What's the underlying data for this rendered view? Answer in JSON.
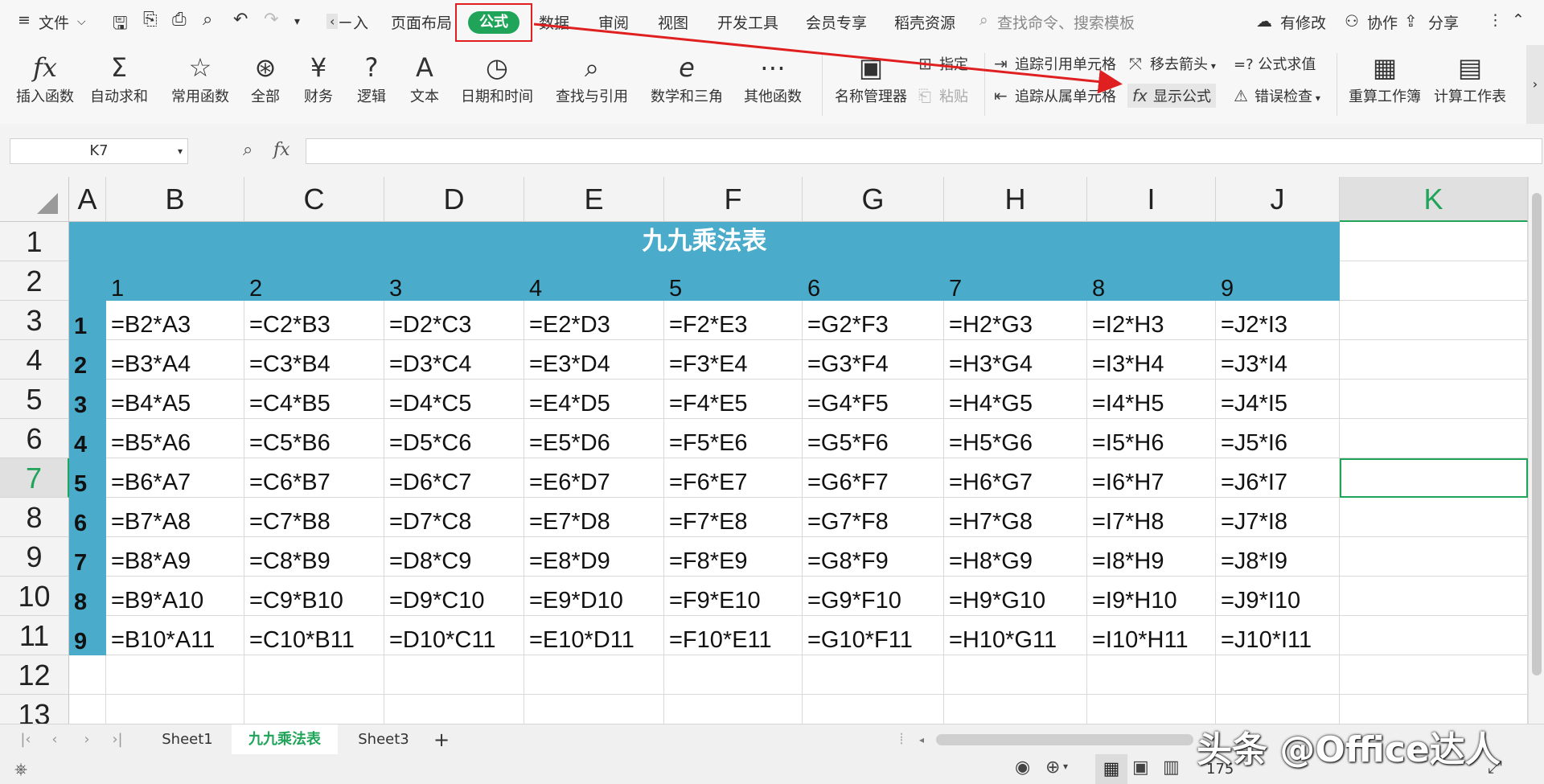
{
  "menu": {
    "file_label": "文件",
    "tabs": [
      "ㄧ入",
      "页面布局",
      "公式",
      "数据",
      "审阅",
      "视图",
      "开发工具",
      "会员专享",
      "稻壳资源"
    ],
    "active_tab": "公式",
    "search_placeholder": "查找命令、搜索模板",
    "right_actions": [
      "有修改",
      "协作",
      "分享"
    ]
  },
  "ribbon": {
    "big_buttons": [
      "插入函数",
      "自动求和",
      "常用函数",
      "全部",
      "财务",
      "逻辑",
      "文本",
      "日期和时间",
      "查找与引用",
      "数学和三角",
      "其他函数",
      "名称管理器"
    ],
    "assign": "指定",
    "paste": "粘贴",
    "trace_precedents": "追踪引用单元格",
    "trace_dependents": "追踪从属单元格",
    "remove_arrows": "移去箭头",
    "show_formulas": "显示公式",
    "evaluate": "=? 公式求值",
    "error_check": "错误检查",
    "recalc_workbook": "重算工作簿",
    "calc_sheet": "计算工作表"
  },
  "formula_bar": {
    "name_box": "K7",
    "fx": "fx",
    "value": ""
  },
  "grid": {
    "columns": [
      "A",
      "B",
      "C",
      "D",
      "E",
      "F",
      "G",
      "H",
      "I",
      "J",
      "K"
    ],
    "rows": [
      "1",
      "2",
      "3",
      "4",
      "5",
      "6",
      "7",
      "8",
      "9",
      "10",
      "11",
      "12",
      "13"
    ],
    "title": "九九乘法表",
    "header_row": [
      "1",
      "2",
      "3",
      "4",
      "5",
      "6",
      "7",
      "8",
      "9"
    ],
    "row_labels": [
      "1",
      "2",
      "3",
      "4",
      "5",
      "6",
      "7",
      "8",
      "9"
    ],
    "formulas": [
      [
        "=B2*A3",
        "=C2*B3",
        "=D2*C3",
        "=E2*D3",
        "=F2*E3",
        "=G2*F3",
        "=H2*G3",
        "=I2*H3",
        "=J2*I3"
      ],
      [
        "=B3*A4",
        "=C3*B4",
        "=D3*C4",
        "=E3*D4",
        "=F3*E4",
        "=G3*F4",
        "=H3*G4",
        "=I3*H4",
        "=J3*I4"
      ],
      [
        "=B4*A5",
        "=C4*B5",
        "=D4*C5",
        "=E4*D5",
        "=F4*E5",
        "=G4*F5",
        "=H4*G5",
        "=I4*H5",
        "=J4*I5"
      ],
      [
        "=B5*A6",
        "=C5*B6",
        "=D5*C6",
        "=E5*D6",
        "=F5*E6",
        "=G5*F6",
        "=H5*G6",
        "=I5*H6",
        "=J5*I6"
      ],
      [
        "=B6*A7",
        "=C6*B7",
        "=D6*C7",
        "=E6*D7",
        "=F6*E7",
        "=G6*F7",
        "=H6*G7",
        "=I6*H7",
        "=J6*I7"
      ],
      [
        "=B7*A8",
        "=C7*B8",
        "=D7*C8",
        "=E7*D8",
        "=F7*E8",
        "=G7*F8",
        "=H7*G8",
        "=I7*H8",
        "=J7*I8"
      ],
      [
        "=B8*A9",
        "=C8*B9",
        "=D8*C9",
        "=E8*D9",
        "=F8*E9",
        "=G8*F9",
        "=H8*G9",
        "=I8*H9",
        "=J8*I9"
      ],
      [
        "=B9*A10",
        "=C9*B10",
        "=D9*C10",
        "=E9*D10",
        "=F9*E10",
        "=G9*F10",
        "=H9*G10",
        "=I9*H10",
        "=J9*I10"
      ],
      [
        "=B10*A11",
        "=C10*B11",
        "=D10*C11",
        "=E10*D11",
        "=F10*E11",
        "=G10*F11",
        "=H10*G11",
        "=I10*H11",
        "=J10*I11"
      ]
    ],
    "selected_cell": "K7"
  },
  "sheets": [
    "Sheet1",
    "九九乘法表",
    "Sheet3"
  ],
  "active_sheet": "九九乘法表",
  "status": {
    "zoom": "175"
  },
  "watermark": "头条 @Office达人",
  "colors": {
    "accent_green": "#1fa45a",
    "table_teal": "#4aabca",
    "highlight_red": "#e02020"
  }
}
